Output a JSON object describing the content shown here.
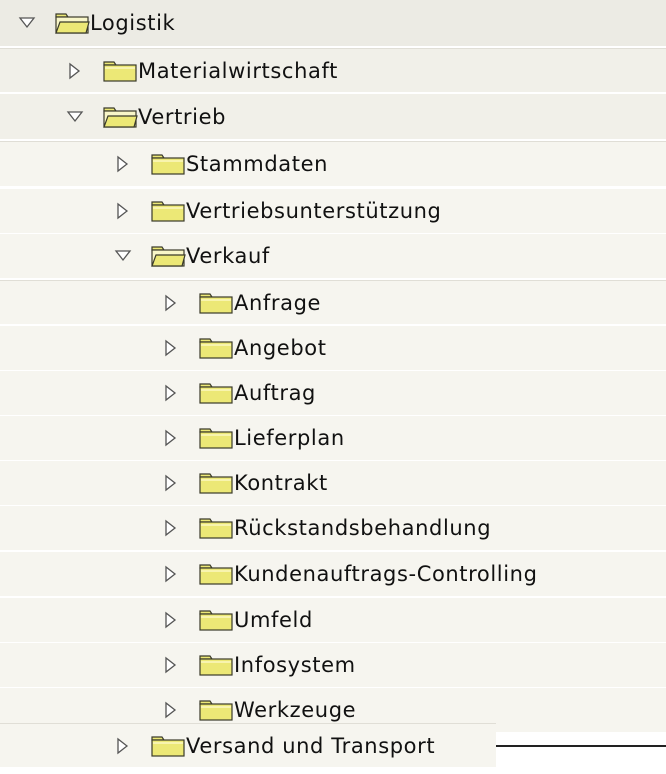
{
  "colors": {
    "row_band_1": "#ecebe4",
    "row_band_2": "#f1f0e9",
    "row_band_3": "#f6f5ef",
    "row_band_4": "#f6f5ef",
    "folder_fill": "#ece876",
    "folder_stroke": "#3a3a2a",
    "toggle_stroke": "#555555"
  },
  "tree": {
    "items": [
      {
        "label": "Logistik",
        "state": "expanded",
        "level": 0,
        "icon": "folder-open-icon"
      },
      {
        "label": "Materialwirtschaft",
        "state": "collapsed",
        "level": 1,
        "icon": "folder-closed-icon"
      },
      {
        "label": "Vertrieb",
        "state": "expanded",
        "level": 1,
        "icon": "folder-open-icon"
      },
      {
        "label": "Stammdaten",
        "state": "collapsed",
        "level": 2,
        "icon": "folder-closed-icon"
      },
      {
        "label": "Vertriebsunterstützung",
        "state": "collapsed",
        "level": 2,
        "icon": "folder-closed-icon"
      },
      {
        "label": "Verkauf",
        "state": "expanded",
        "level": 2,
        "icon": "folder-open-icon"
      },
      {
        "label": "Anfrage",
        "state": "collapsed",
        "level": 3,
        "icon": "folder-closed-icon"
      },
      {
        "label": "Angebot",
        "state": "collapsed",
        "level": 3,
        "icon": "folder-closed-icon"
      },
      {
        "label": "Auftrag",
        "state": "collapsed",
        "level": 3,
        "icon": "folder-closed-icon"
      },
      {
        "label": "Lieferplan",
        "state": "collapsed",
        "level": 3,
        "icon": "folder-closed-icon"
      },
      {
        "label": "Kontrakt",
        "state": "collapsed",
        "level": 3,
        "icon": "folder-closed-icon"
      },
      {
        "label": "Rückstandsbehandlung",
        "state": "collapsed",
        "level": 3,
        "icon": "folder-closed-icon"
      },
      {
        "label": "Kundenauftrags-Controlling",
        "state": "collapsed",
        "level": 3,
        "icon": "folder-closed-icon"
      },
      {
        "label": "Umfeld",
        "state": "collapsed",
        "level": 3,
        "icon": "folder-closed-icon"
      },
      {
        "label": "Infosystem",
        "state": "collapsed",
        "level": 3,
        "icon": "folder-closed-icon"
      },
      {
        "label": "Werkzeuge",
        "state": "collapsed",
        "level": 3,
        "icon": "folder-closed-icon"
      },
      {
        "label": "Versand und Transport",
        "state": "collapsed",
        "level": 2,
        "icon": "folder-closed-icon"
      }
    ]
  }
}
